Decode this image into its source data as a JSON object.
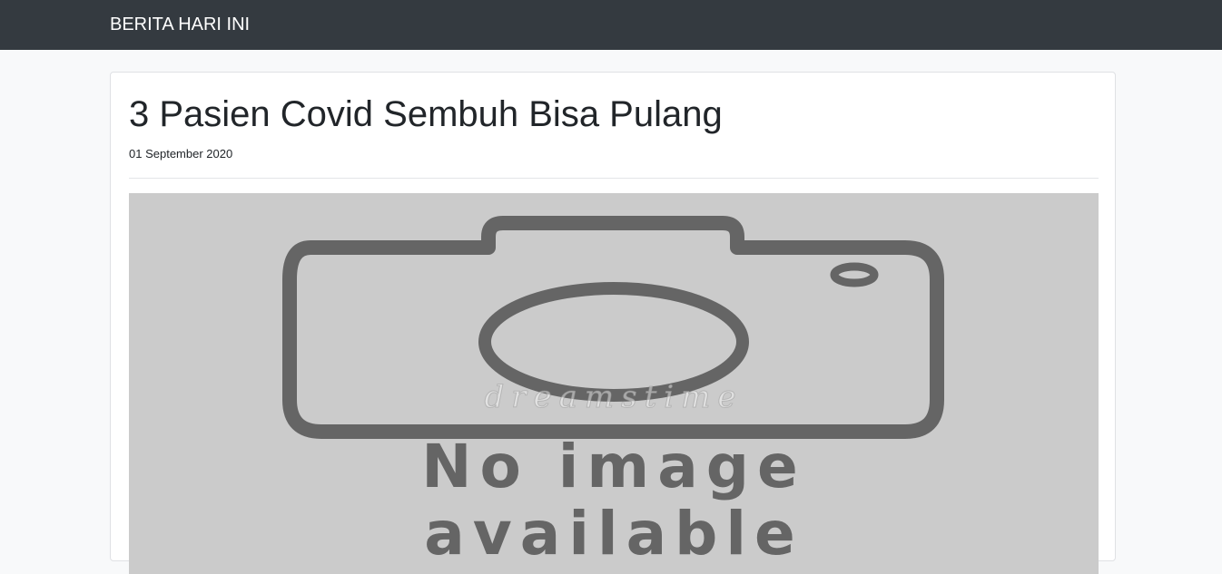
{
  "navbar": {
    "brand": "BERITA HARI INI"
  },
  "article": {
    "title": "3 Pasien Covid Sembuh Bisa Pulang",
    "date": "01 September 2020",
    "image": {
      "placeholder_line1": "No image",
      "placeholder_line2": "available",
      "watermark": "dreamstime"
    }
  },
  "colors": {
    "navbar_bg": "#343a40",
    "page_bg": "#f8f9fa",
    "image_bg": "#cbcbcb",
    "icon_color": "#656565"
  },
  "icons": [
    "camera-icon"
  ]
}
